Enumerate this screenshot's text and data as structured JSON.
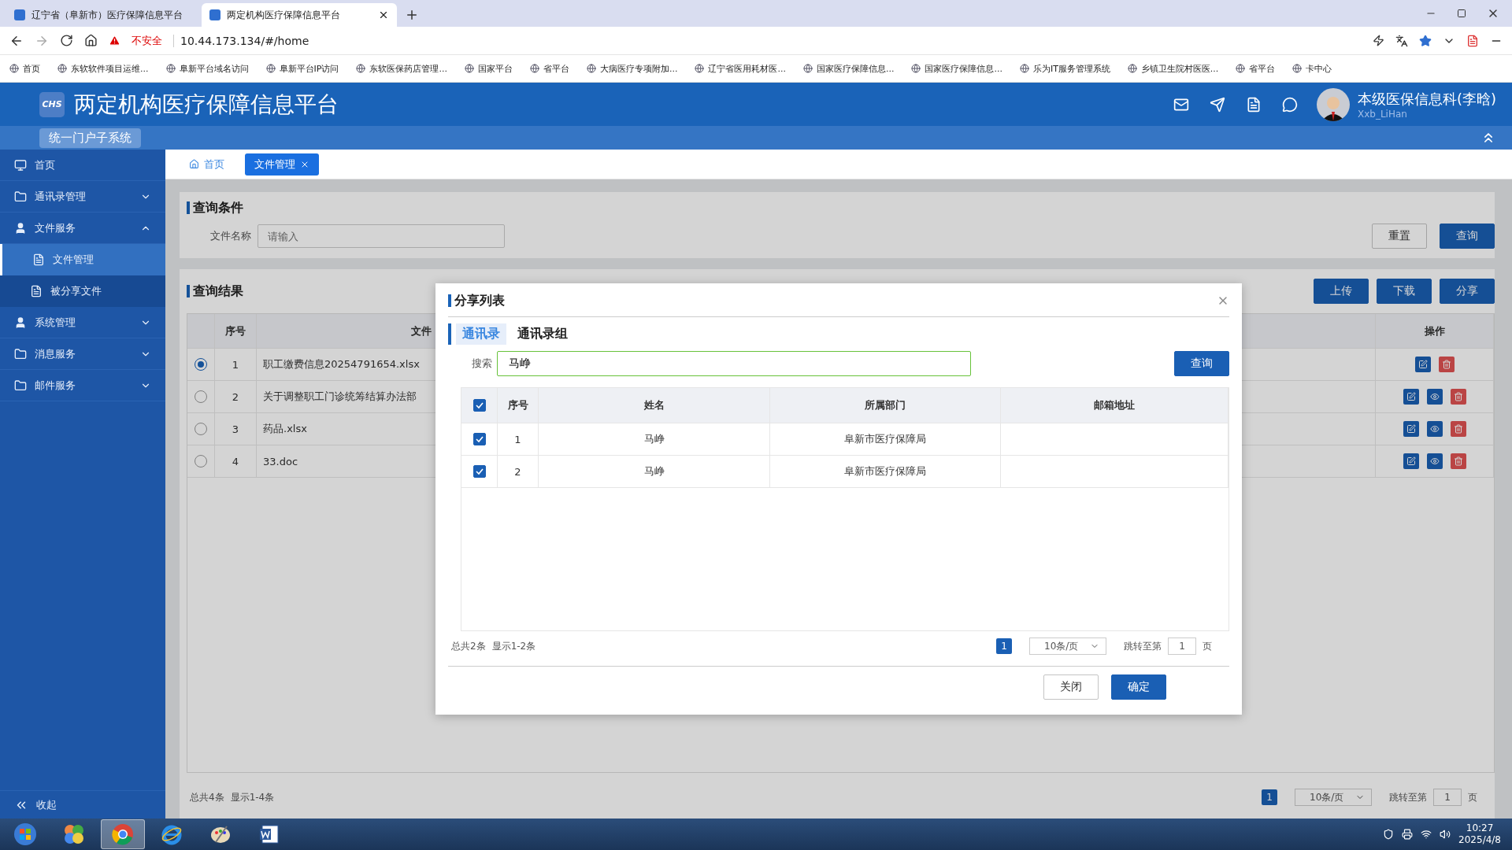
{
  "browser": {
    "tabs": [
      {
        "title": "辽宁省（阜新市）医疗保障信息平台",
        "selected": false
      },
      {
        "title": "两定机构医疗保障信息平台",
        "selected": true
      }
    ],
    "security_label": "不安全",
    "url": "10.44.173.134/#/home",
    "bookmarks": [
      "首页",
      "东软软件项目运维...",
      "阜新平台域名访问",
      "阜新平台IP访问",
      "东软医保药店管理...",
      "国家平台",
      "省平台",
      "大病医疗专项附加...",
      "辽宁省医用耗材医...",
      "国家医疗保障信息...",
      "国家医疗保障信息...",
      "乐为IT服务管理系统",
      "乡镇卫生院村医医...",
      "省平台",
      "卡中心"
    ]
  },
  "header": {
    "logo_text": "CHS",
    "title": "两定机构医疗保障信息平台",
    "subsystem": "统一门户子系统",
    "user_name": "本级医保信息科(李晗)",
    "user_id": "Xxb_LiHan"
  },
  "sidebar": {
    "items": [
      {
        "label": "首页",
        "kind": "monitor",
        "selected": false
      },
      {
        "label": "通讯录管理",
        "kind": "folder",
        "expanded": false
      },
      {
        "label": "文件服务",
        "kind": "user",
        "expanded": true,
        "children": [
          {
            "label": "文件管理",
            "selected": true
          },
          {
            "label": "被分享文件",
            "selected": false
          }
        ]
      },
      {
        "label": "系统管理",
        "kind": "user",
        "expanded": false
      },
      {
        "label": "消息服务",
        "kind": "folder",
        "expanded": false
      },
      {
        "label": "邮件服务",
        "kind": "folder",
        "expanded": false
      }
    ],
    "collapse_label": "收起"
  },
  "page_tabs": [
    {
      "label": "首页",
      "kind": "home",
      "selected": false
    },
    {
      "label": "文件管理",
      "kind": "page",
      "selected": true
    }
  ],
  "query": {
    "title": "查询条件",
    "field_label": "文件名称",
    "placeholder": "请输入",
    "buttons": [
      {
        "label": "重置",
        "kind": "default"
      },
      {
        "label": "查询",
        "kind": "primary"
      }
    ]
  },
  "results": {
    "title": "查询结果",
    "buttons": [
      "上传",
      "下载",
      "分享"
    ],
    "columns": [
      "序号",
      "文件",
      "操作"
    ],
    "rows": [
      {
        "selected": true,
        "index": "1",
        "file": "职工缴费信息20254791654.xlsx",
        "actions": [
          {
            "kind": "edit"
          },
          {
            "kind": "delete"
          }
        ]
      },
      {
        "selected": false,
        "index": "2",
        "file": "关于调整职工门诊统筹结算办法部",
        "actions": [
          {
            "kind": "edit"
          },
          {
            "kind": "view"
          },
          {
            "kind": "delete"
          }
        ]
      },
      {
        "selected": false,
        "index": "3",
        "file": "药品.xlsx",
        "actions": [
          {
            "kind": "edit"
          },
          {
            "kind": "view"
          },
          {
            "kind": "delete"
          }
        ]
      },
      {
        "selected": false,
        "index": "4",
        "file": "33.doc",
        "actions": [
          {
            "kind": "edit"
          },
          {
            "kind": "view"
          },
          {
            "kind": "delete"
          }
        ]
      }
    ],
    "pagination": {
      "summary": "总共4条",
      "range": "显示1-4条",
      "current_page": "1",
      "page_size": "10条/页",
      "jump_label": "跳转至第",
      "jump_value": "1",
      "page_suffix": "页"
    }
  },
  "modal": {
    "title": "分享列表",
    "tabs": [
      {
        "label": "通讯录",
        "selected": true
      },
      {
        "label": "通讯录组",
        "selected": false
      }
    ],
    "search_label": "搜索",
    "search_value": "马峥",
    "search_button": "查询",
    "all_checked": true,
    "columns": [
      "序号",
      "姓名",
      "所属部门",
      "邮箱地址"
    ],
    "rows": [
      {
        "checked": true,
        "index": "1",
        "name": "马峥",
        "department": "阜新市医疗保障局"
      },
      {
        "checked": true,
        "index": "2",
        "name": "马峥",
        "department": "阜新市医疗保障局"
      }
    ],
    "pagination": {
      "summary": "总共2条",
      "range": "显示1-2条",
      "current_page": "1",
      "page_size": "10条/页",
      "jump_label": "跳转至第",
      "jump_value": "1",
      "page_suffix": "页"
    },
    "buttons": [
      {
        "label": "关闭",
        "kind": "default"
      },
      {
        "label": "确定",
        "kind": "primary"
      }
    ]
  },
  "taskbar": {
    "apps": [
      {
        "kind": "start",
        "selected": false
      },
      {
        "kind": "tiles",
        "selected": false
      },
      {
        "kind": "browser",
        "selected": true
      },
      {
        "kind": "ie",
        "selected": false
      },
      {
        "kind": "paint",
        "selected": false
      },
      {
        "kind": "word",
        "selected": false
      }
    ],
    "time": "10:27",
    "date": "2025/4/8"
  }
}
